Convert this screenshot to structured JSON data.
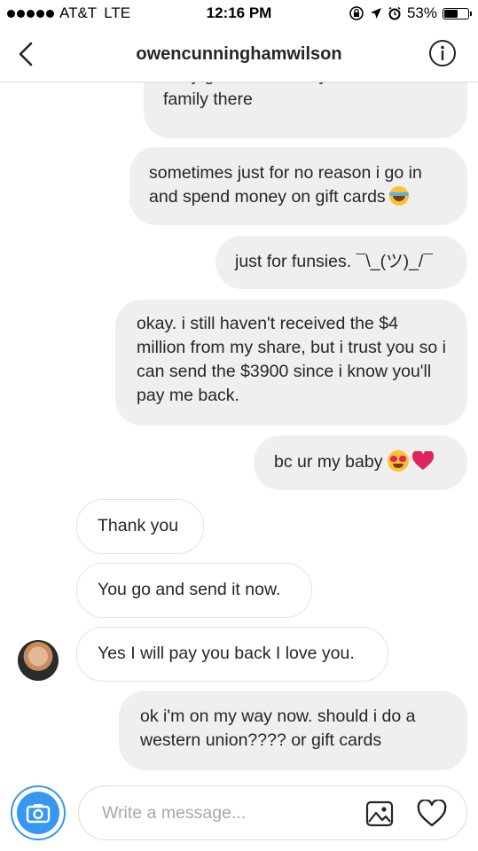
{
  "status_bar": {
    "carrier": "AT&T",
    "network": "LTE",
    "time": "12:16 PM",
    "battery": "53%",
    "battery_level": 0.53
  },
  "header": {
    "title": "owencunninghamwilson"
  },
  "messages": [
    {
      "sender": "me",
      "text": "i buy gift cards for my friends and family there"
    },
    {
      "sender": "me",
      "text": "sometimes just for no reason i go in and spend money on gift cards",
      "emoji": "face-with-tears-of-joy"
    },
    {
      "sender": "me",
      "text": "just for funsies.  ¯\\_(ツ)_/¯"
    },
    {
      "sender": "me",
      "text": "okay.  i still haven't received the $4 million from my share, but i trust you so i can send the $3900 since i know you'll pay me back."
    },
    {
      "sender": "me",
      "text": "bc ur my baby",
      "emoji": "heart-eyes, red-heart"
    },
    {
      "sender": "them",
      "text": "Thank you"
    },
    {
      "sender": "them",
      "text": "You go and send it now."
    },
    {
      "sender": "them",
      "text": "Yes I will pay you back I love you."
    },
    {
      "sender": "me",
      "text": "ok i'm on my way now.   should i do a western union???? or gift cards"
    }
  ],
  "composer": {
    "placeholder": "Write a message..."
  },
  "colors": {
    "accent": "#3897f0",
    "outgoing_bubble": "#efefef",
    "incoming_border": "#e3e3e3",
    "heart": "#e0245e"
  }
}
